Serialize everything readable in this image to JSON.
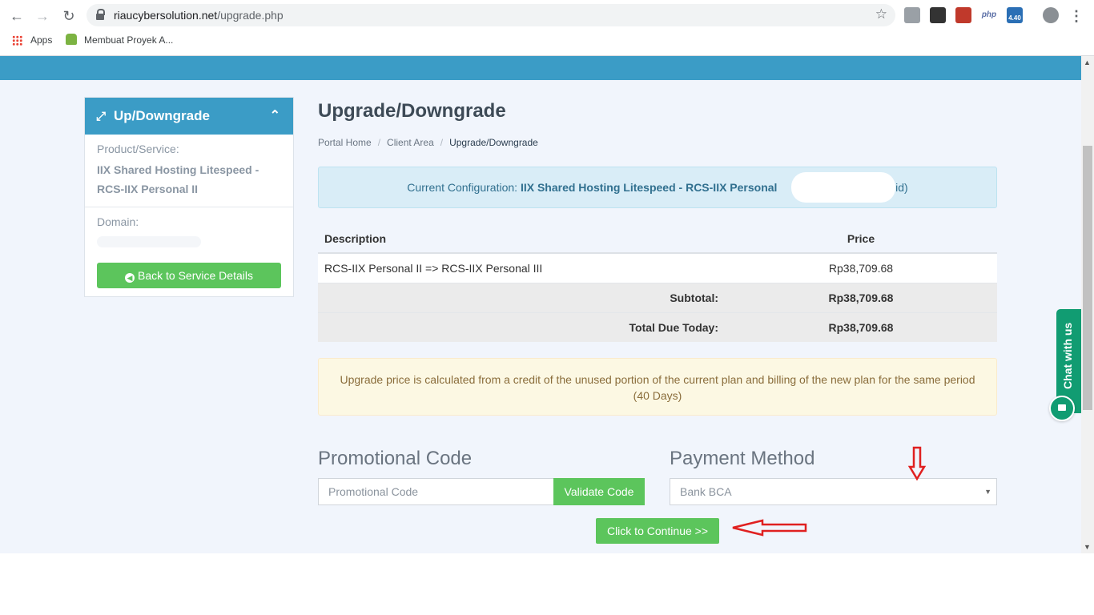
{
  "browser": {
    "url_host": "riaucybersolution.net",
    "url_path": "/upgrade.php",
    "bookmarks": [
      {
        "label": "Apps"
      },
      {
        "label": "Membuat Proyek A..."
      }
    ],
    "ext_php": "php",
    "ext_version": "4.40"
  },
  "sidebar": {
    "title": "Up/Downgrade",
    "product_label": "Product/Service:",
    "product_line1": "IIX Shared Hosting Litespeed -",
    "product_line2": "RCS-IIX Personal II",
    "domain_label": "Domain:",
    "back_button": "Back to Service Details"
  },
  "main": {
    "title": "Upgrade/Downgrade",
    "breadcrumb": [
      "Portal Home",
      "Client Area",
      "Upgrade/Downgrade"
    ],
    "config_prefix": "Current Configuration: ",
    "config_value": "IIX Shared Hosting Litespeed - RCS-IIX Personal",
    "config_suffix": "t.id)",
    "table": {
      "headers": [
        "Description",
        "Price"
      ],
      "rows": [
        {
          "description": "RCS-IIX Personal II => RCS-IIX Personal III",
          "price": "Rp38,709.68"
        }
      ],
      "subtotal_label": "Subtotal:",
      "subtotal_value": "Rp38,709.68",
      "total_label": "Total Due Today:",
      "total_value": "Rp38,709.68"
    },
    "note": "Upgrade price is calculated from a credit of the unused portion of the current plan and billing of the new plan for the same period (40 Days)",
    "promo_title": "Promotional Code",
    "promo_placeholder": "Promotional Code",
    "validate_button": "Validate Code",
    "payment_title": "Payment Method",
    "payment_selected": "Bank BCA",
    "continue_button": "Click to Continue >>"
  },
  "chat": {
    "label": "Chat with us"
  },
  "colors": {
    "brand_blue": "#3b9cc6",
    "button_green": "#5cc55c",
    "chat_green": "#119c72",
    "annotation_red": "#e02020"
  }
}
